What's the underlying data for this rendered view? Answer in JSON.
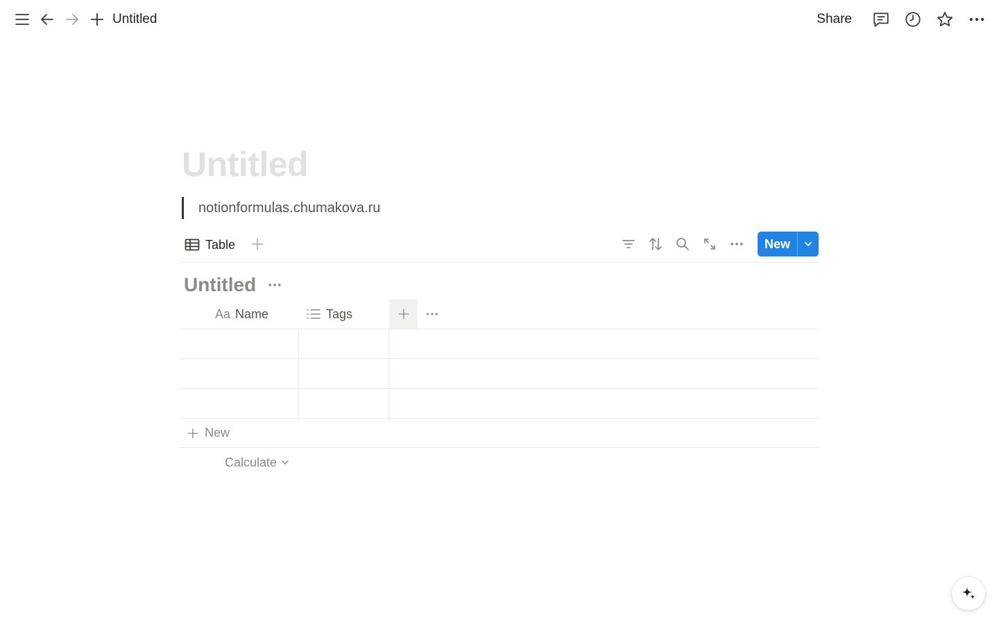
{
  "topbar": {
    "breadcrumb_title": "Untitled",
    "share_label": "Share",
    "icons": [
      "menu-icon",
      "back-arrow-icon",
      "forward-arrow-icon",
      "plus-icon",
      "comment-icon",
      "clock-icon",
      "star-icon",
      "more-icon"
    ]
  },
  "page": {
    "title": "Untitled",
    "quote": "notionformulas.chumakova.ru"
  },
  "view": {
    "tab_label": "Table",
    "new_label": "New",
    "tool_icons": [
      "filter-icon",
      "sort-icon",
      "search-icon",
      "expand-icon",
      "more-icon"
    ]
  },
  "database": {
    "title": "Untitled",
    "columns": [
      {
        "icon": "text-icon",
        "icon_text": "Aa",
        "label": "Name"
      },
      {
        "icon": "list-icon",
        "label": "Tags"
      }
    ],
    "rows": [
      {
        "name": "",
        "tags": ""
      },
      {
        "name": "",
        "tags": ""
      },
      {
        "name": "",
        "tags": ""
      }
    ],
    "add_row_label": "New",
    "calculate_label": "Calculate"
  },
  "colors": {
    "accent": "#2383e2",
    "text": "#37352f",
    "muted": "#8b8a86",
    "title_placeholder": "#e1e1e0",
    "border": "#e9e9e7"
  }
}
